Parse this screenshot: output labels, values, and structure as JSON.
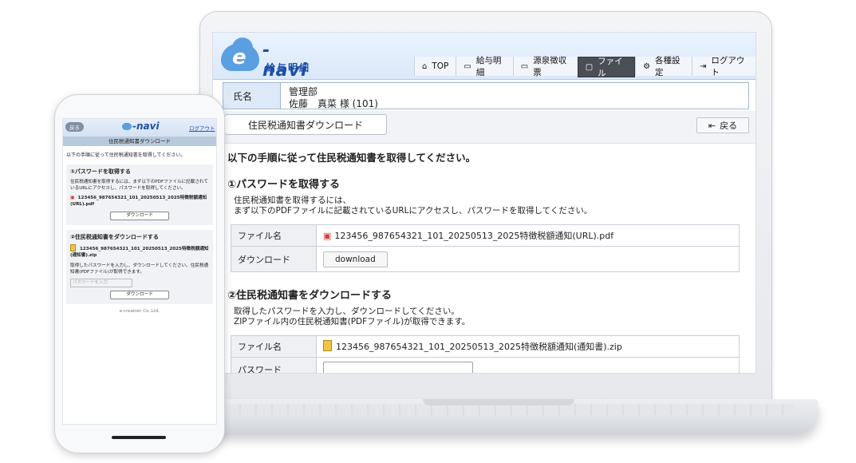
{
  "laptop": {
    "logo": {
      "text": "-navi",
      "sub": "給与明細"
    },
    "nav": [
      {
        "label": "TOP",
        "icon": "home-icon",
        "glyph": "⌂"
      },
      {
        "label": "給与明細",
        "icon": "monitor-icon",
        "glyph": "▭"
      },
      {
        "label": "源泉徴収票",
        "icon": "monitor-icon",
        "glyph": "▭"
      },
      {
        "label": "ファイル",
        "icon": "file-icon",
        "glyph": "▢"
      },
      {
        "label": "各種設定",
        "icon": "gear-icon",
        "glyph": "⚙"
      },
      {
        "label": "ログアウト",
        "icon": "logout-icon",
        "glyph": "⇥"
      }
    ],
    "name_label": "氏名",
    "department": "管理部",
    "person": "佐藤　真菜 様 (101)",
    "page_title": "住民税通知書ダウンロード",
    "back_label": "戻る",
    "intro": "以下の手順に従って住民税通知書を取得してください。",
    "step1": {
      "title": "①パスワードを取得する",
      "desc1": "住民税通知書を取得するには、",
      "desc2": "まず以下のPDFファイルに記載されているURLにアクセスし、パスワードを取得してください。",
      "file_label": "ファイル名",
      "file_name": "123456_987654321_101_20250513_2025特徴税額通知(URL).pdf",
      "download_label": "ダウンロード",
      "download_button": "download"
    },
    "step2": {
      "title": "②住民税通知書をダウンロードする",
      "desc1": "取得したパスワードを入力し、ダウンロードしてください。",
      "desc2": "ZIPファイル内の住民税通知書(PDFファイル)が取得できます。",
      "file_label": "ファイル名",
      "file_name": "123456_987654321_101_20250513_2025特徴税額通知(通知書).zip",
      "password_label": "パスワード"
    }
  },
  "phone": {
    "back": "戻る",
    "logo": "-navi",
    "logout": "ログアウト",
    "title": "住民税通知書ダウンロード",
    "intro": "以下の手順に従って住民税通知書を取得してください。",
    "step1": {
      "title": "①パスワードを取得する",
      "desc": "住民税通知書を取得するには、まず以下のPDFファイルに記載されているURLにアクセスし、パスワードを取得してください。",
      "file": "123456_987654321_101_20250513_2025特徴税額通知(URL).pdf",
      "button": "ダウンロード"
    },
    "step2": {
      "title": "②住民税通知書をダウンロードする",
      "file": "123456_987654321_101_20250513_2025特徴税額通知(通知書).zip",
      "desc": "取得したパスワードを入力し、ダウンロードしてください。住民税通知書(PDFファイル)が取得できます。",
      "placeholder": "パスワードを入力",
      "button": "ダウンロード"
    },
    "footer": "e-creation Co.,Ltd."
  }
}
